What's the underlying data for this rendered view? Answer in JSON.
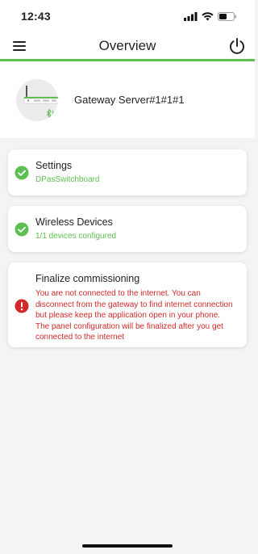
{
  "status_bar": {
    "time": "12:43"
  },
  "header": {
    "title": "Overview",
    "menu_icon": "hamburger-menu-icon",
    "power_icon": "power-icon"
  },
  "colors": {
    "accent": "#5cbf4f",
    "error": "#d22a2a"
  },
  "gateway": {
    "name": "Gateway Server#1#1#1"
  },
  "cards": [
    {
      "title": "Settings",
      "subtitle": "DPasSwitchboard",
      "status": "ok"
    },
    {
      "title": "Wireless Devices",
      "subtitle": "1/1 devices configured",
      "status": "ok"
    },
    {
      "title": "Finalize commissioning",
      "message": "You are not connected to the internet. You can disconnect from the gateway to find internet connection but please keep the application open in your phone. The panel configuration will be finalized after you get connected to the internet",
      "status": "error"
    }
  ]
}
